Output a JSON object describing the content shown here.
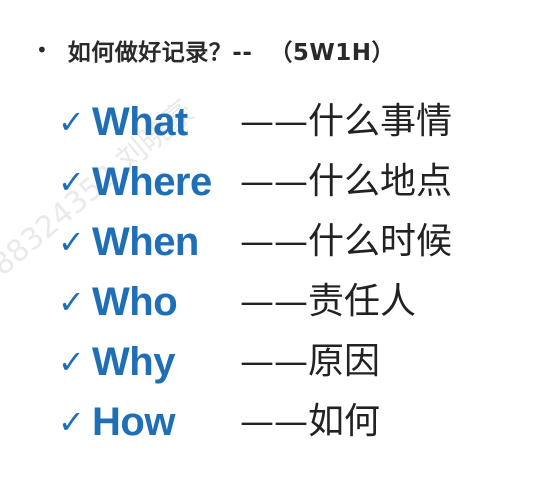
{
  "heading": {
    "bullet": "•",
    "text": "如何做好记录？--  （5W1H）"
  },
  "items": [
    {
      "check": "✓",
      "word": "What",
      "dash": "——",
      "meaning": "什么事情"
    },
    {
      "check": "✓",
      "word": "Where",
      "dash": "——",
      "meaning": "什么地点"
    },
    {
      "check": "✓",
      "word": "When",
      "dash": "——",
      "meaning": "什么时候"
    },
    {
      "check": "✓",
      "word": "Who",
      "dash": "——",
      "meaning": "责任人"
    },
    {
      "check": "✓",
      "word": "Why",
      "dash": "——",
      "meaning": "原因"
    },
    {
      "check": "✓",
      "word": "How",
      "dash": "——",
      "meaning": "如何"
    }
  ],
  "watermark": "88324352 刘晓豪",
  "colors": {
    "accent": "#1f6fb6",
    "text": "#222222"
  }
}
